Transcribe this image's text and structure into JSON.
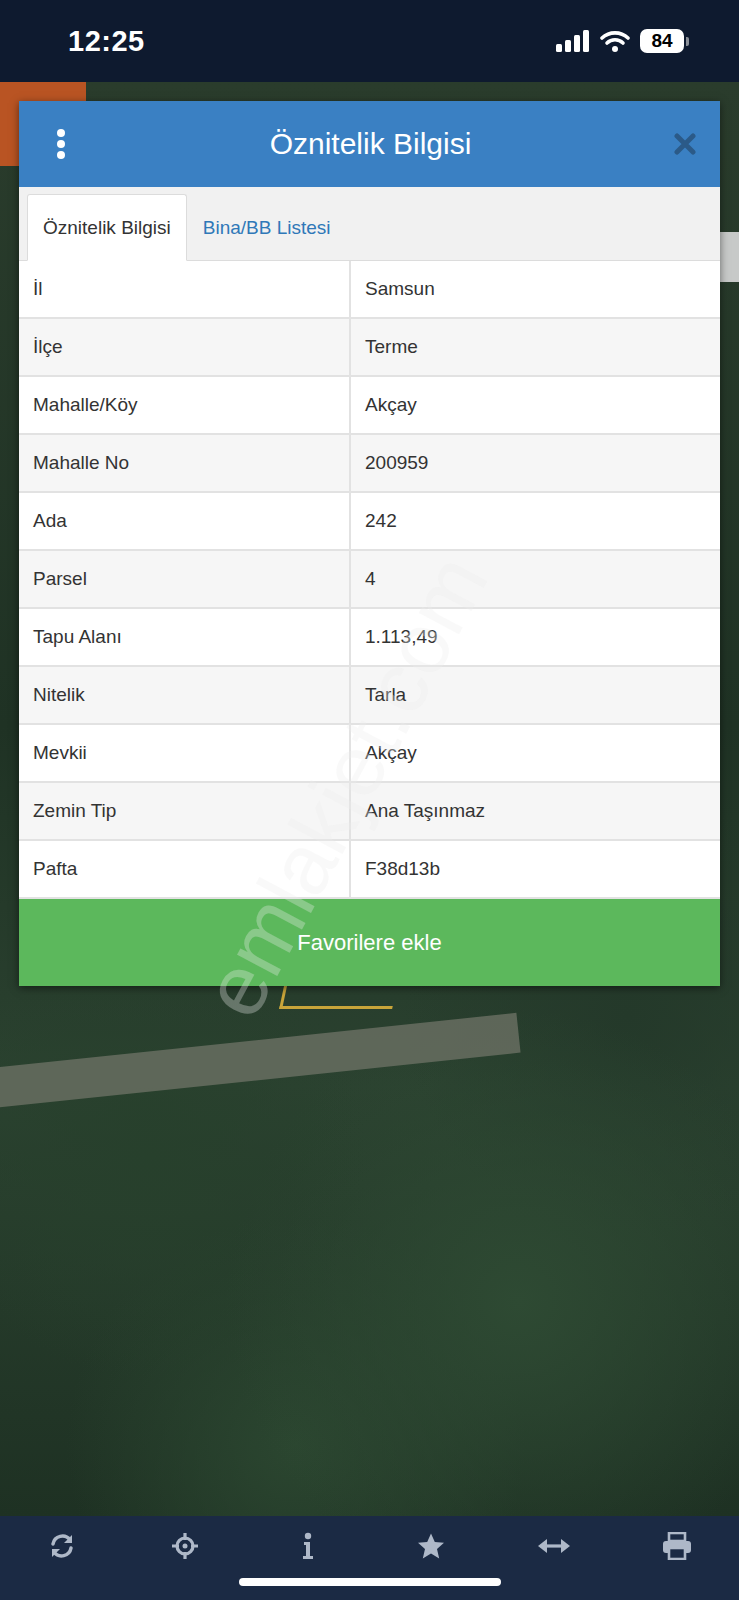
{
  "status_bar": {
    "time": "12:25",
    "battery": "84"
  },
  "dialog": {
    "title": "Öznitelik Bilgisi"
  },
  "tabs": [
    {
      "label": "Öznitelik Bilgisi",
      "selected": true
    },
    {
      "label": "Bina/BB Listesi",
      "selected": false
    }
  ],
  "attributes": [
    {
      "label": "İl",
      "value": "Samsun"
    },
    {
      "label": "İlçe",
      "value": "Terme"
    },
    {
      "label": "Mahalle/Köy",
      "value": "Akçay"
    },
    {
      "label": "Mahalle No",
      "value": "200959"
    },
    {
      "label": "Ada",
      "value": "242"
    },
    {
      "label": "Parsel",
      "value": "4"
    },
    {
      "label": "Tapu Alanı",
      "value": "1.113,49"
    },
    {
      "label": "Nitelik",
      "value": "Tarla"
    },
    {
      "label": "Mevkii",
      "value": "Akçay"
    },
    {
      "label": "Zemin Tip",
      "value": "Ana Taşınmaz"
    },
    {
      "label": "Pafta",
      "value": "F38d13b"
    }
  ],
  "button": "Favorilere ekle",
  "watermark": "emlakjet.com"
}
